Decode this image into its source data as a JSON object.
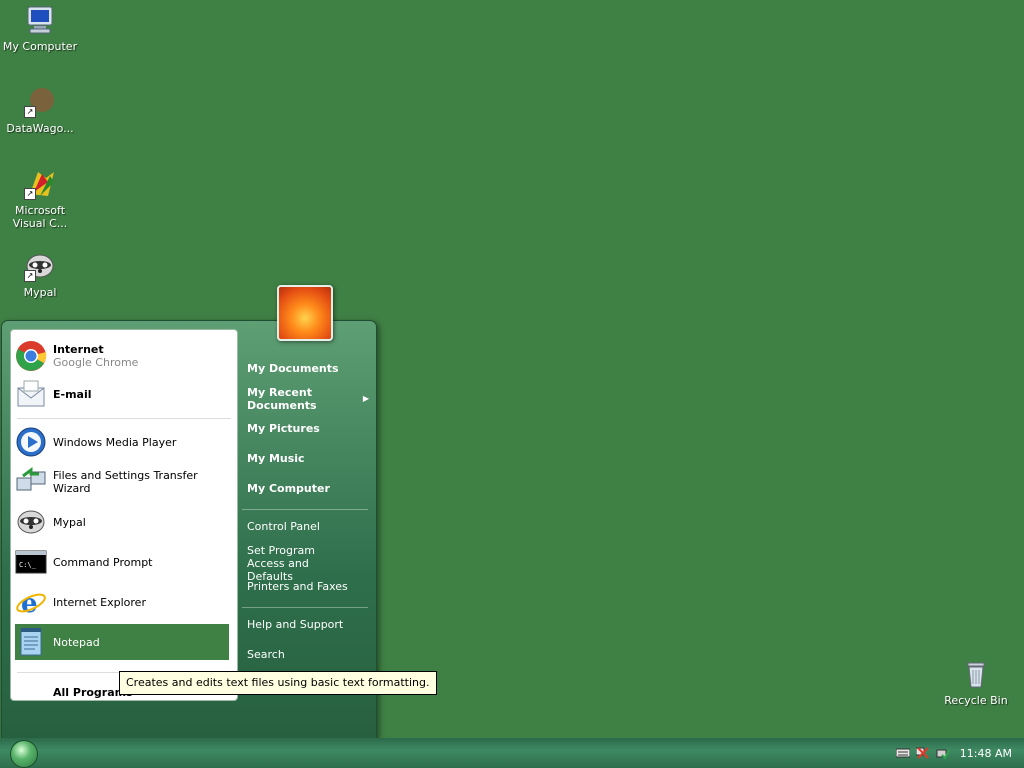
{
  "desktop": {
    "icons": [
      {
        "label": "My Computer",
        "icon": "my-computer-icon"
      },
      {
        "label": "DataWago...",
        "icon": "datawagon-icon"
      },
      {
        "label": "Microsoft\nVisual C...",
        "icon": "visual-studio-icon"
      },
      {
        "label": "Mypal",
        "icon": "mypal-icon"
      },
      {
        "label": "Recycle Bin",
        "icon": "recycle-bin-icon"
      }
    ]
  },
  "start_menu": {
    "pinned": [
      {
        "title": "Internet",
        "subtitle": "Google Chrome",
        "icon": "chrome-icon"
      },
      {
        "title": "E-mail",
        "icon": "email-icon"
      }
    ],
    "recent": [
      {
        "label": "Windows Media Player",
        "icon": "media-player-icon"
      },
      {
        "label": "Files and Settings Transfer Wizard",
        "icon": "transfer-wizard-icon"
      },
      {
        "label": "Mypal",
        "icon": "mypal-icon"
      },
      {
        "label": "Command Prompt",
        "icon": "command-prompt-icon"
      },
      {
        "label": "Internet Explorer",
        "icon": "internet-explorer-icon"
      },
      {
        "label": "Notepad",
        "icon": "notepad-icon"
      }
    ],
    "all_programs": "All Programs",
    "right": {
      "my_documents": "My Documents",
      "my_recent_documents": "My Recent Documents",
      "my_pictures": "My Pictures",
      "my_music": "My Music",
      "my_computer": "My Computer",
      "control_panel": "Control Panel",
      "set_program_access": "Set Program Access and Defaults",
      "printers_faxes": "Printers and Faxes",
      "help_support": "Help and Support",
      "search": "Search"
    },
    "tooltip": "Creates and edits text files using basic text formatting."
  },
  "taskbar": {
    "clock": "11:48 AM"
  },
  "colors": {
    "desktop": "#3f8044",
    "selected_item": "#3f8044",
    "menu_dark": "#27603f"
  }
}
